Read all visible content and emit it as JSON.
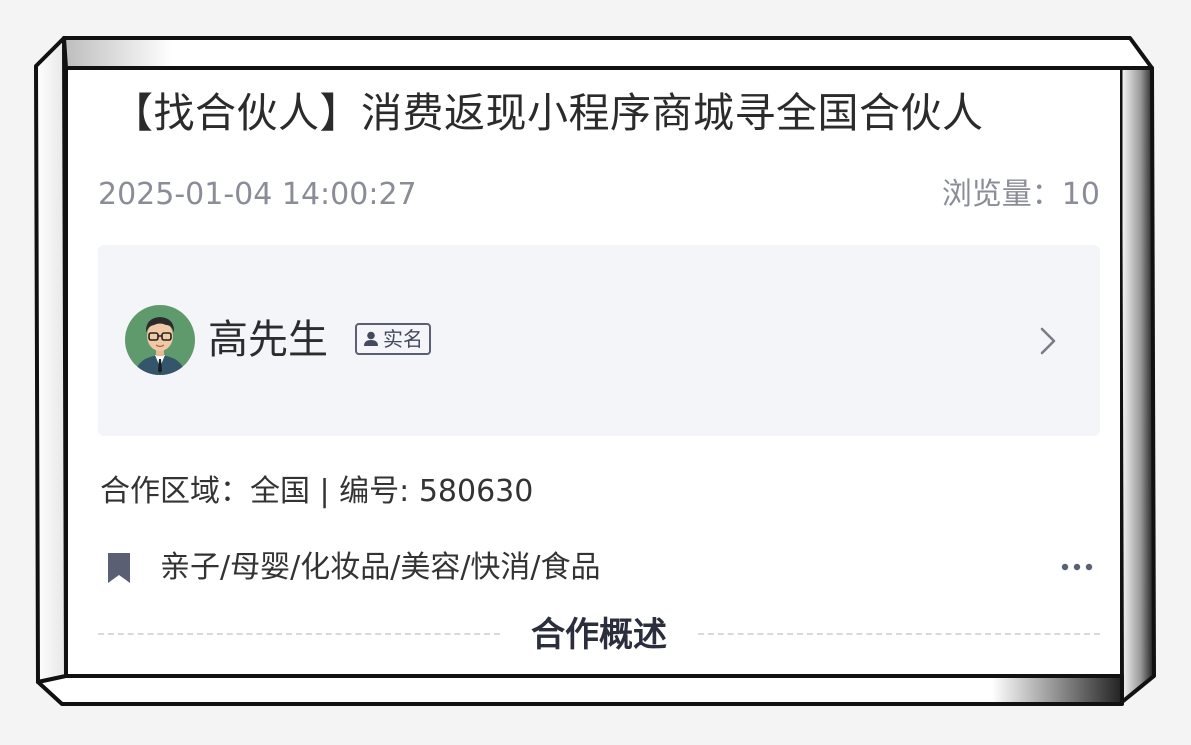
{
  "post": {
    "title": "【找合伙人】消费返现小程序商城寻全国合伙人",
    "date": "2025-01-04 14:00:27",
    "views": "浏览量：10"
  },
  "user": {
    "name": "高先生",
    "badge": "实名",
    "avatar_icon": "male-avatar-glasses-icon"
  },
  "details": {
    "area_line": "合作区域：全国 | 编号: 580630",
    "tags": "亲子/母婴/化妆品/美容/快消/食品"
  },
  "section": {
    "title": "合作概述"
  },
  "colors": {
    "text_primary": "#2b2b2b",
    "text_secondary": "#8a8d98",
    "card_bg": "#f4f5f9",
    "icon_dark": "#5b5f73"
  }
}
